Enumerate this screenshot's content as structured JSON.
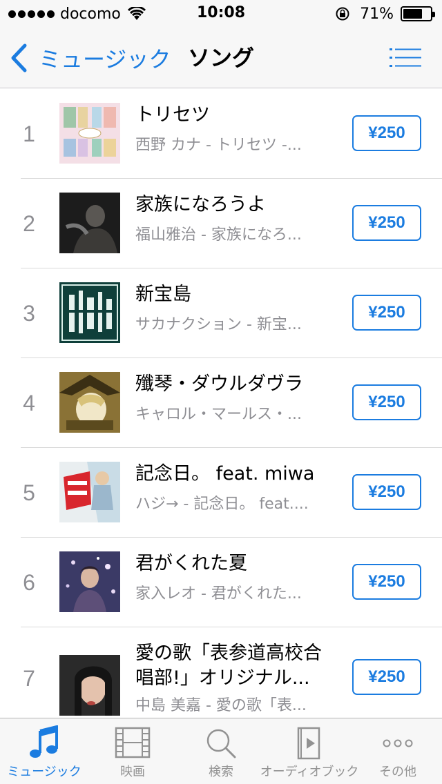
{
  "status_bar": {
    "carrier": "docomo",
    "time": "10:08",
    "battery": "71%",
    "battery_level": 0.71
  },
  "nav": {
    "back_label": "ミュージック",
    "title": "ソング"
  },
  "songs": [
    {
      "rank": "1",
      "title": "トリセツ",
      "subtitle": "西野 カナ - トリセツ -...",
      "price": "¥250"
    },
    {
      "rank": "2",
      "title": "家族になろうよ",
      "subtitle": "福山雅治 - 家族になろ...",
      "price": "¥250"
    },
    {
      "rank": "3",
      "title": "新宝島",
      "subtitle": "サカナクション - 新宝...",
      "price": "¥250"
    },
    {
      "rank": "4",
      "title": "殲琴・ダウルダヴラ",
      "subtitle": "キャロル・マールス・...",
      "price": "¥250"
    },
    {
      "rank": "5",
      "title": "記念日。 feat. miwa",
      "subtitle": "ハジ→ - 記念日。 feat....",
      "price": "¥250"
    },
    {
      "rank": "6",
      "title": "君がくれた夏",
      "subtitle": "家入レオ - 君がくれた...",
      "price": "¥250"
    },
    {
      "rank": "7",
      "title": "愛の歌「表参道高校合",
      "title2": "唱部!」オリジナル...",
      "subtitle": "中島 美嘉 - 愛の歌「表...",
      "price": "¥250"
    }
  ],
  "tabs": [
    {
      "label": "ミュージック",
      "icon": "music-note-icon",
      "active": true
    },
    {
      "label": "映画",
      "icon": "film-icon"
    },
    {
      "label": "検索",
      "icon": "search-icon"
    },
    {
      "label": "オーディオブック",
      "icon": "audiobook-icon"
    },
    {
      "label": "その他",
      "icon": "more-icon"
    }
  ],
  "colors": {
    "accent": "#1b7ce0",
    "secondary_text": "#8e8e93",
    "bar_background": "#f7f7f7"
  }
}
